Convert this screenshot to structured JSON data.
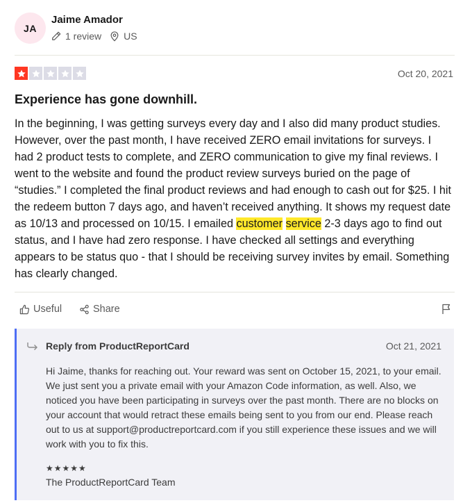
{
  "reviewer": {
    "initials": "JA",
    "name": "Jaime Amador",
    "review_count": "1 review",
    "country": "US"
  },
  "review": {
    "rating": 1,
    "rating_max": 5,
    "date": "Oct 20, 2021",
    "title": "Experience has gone downhill.",
    "body_before": "In the beginning, I was getting surveys every day and I also did many product studies. However, over the past month, I have received ZERO email invitations for surveys. I had 2 product tests to complete, and ZERO communication to give my final reviews. I went to the website and found the product review surveys buried on the page of “studies.” I completed the final product reviews and had enough to cash out for $25. I hit the redeem button 7 days ago, and haven’t received anything. It shows my request date as 10/13 and processed on 10/15. I emailed ",
    "highlight_1": "customer",
    "between": " ",
    "highlight_2": "service",
    "body_after": " 2-3 days ago to find out status, and I have had zero response. I have checked all settings and everything appears to be status quo - that I should be receiving survey invites by email. Something has clearly changed.",
    "star_color_on": "#ff3722",
    "star_color_off": "#dcdce6",
    "highlight_color": "#ffe82b"
  },
  "actions": {
    "useful_label": "Useful",
    "share_label": "Share"
  },
  "reply": {
    "title": "Reply from ProductReportCard",
    "date": "Oct 21, 2021",
    "text": "Hi Jaime, thanks for reaching out. Your reward was sent on October 15, 2021, to your email. We just sent you a private email with your Amazon Code information, as well. Also, we noticed you have been participating in surveys over the past month. There are no blocks on your account that would retract these emails being sent to you from our end. Please reach out to us at support@productreportcard.com if you still experience these issues and we will work with you to fix this.",
    "stars": "★★★★★",
    "signature": "The ProductReportCard Team",
    "accent_color": "#4e6ef5"
  },
  "icons": [
    "pencil-icon",
    "location-pin-icon",
    "star-icon",
    "thumbs-up-icon",
    "share-icon",
    "flag-icon",
    "reply-arrow-icon"
  ]
}
